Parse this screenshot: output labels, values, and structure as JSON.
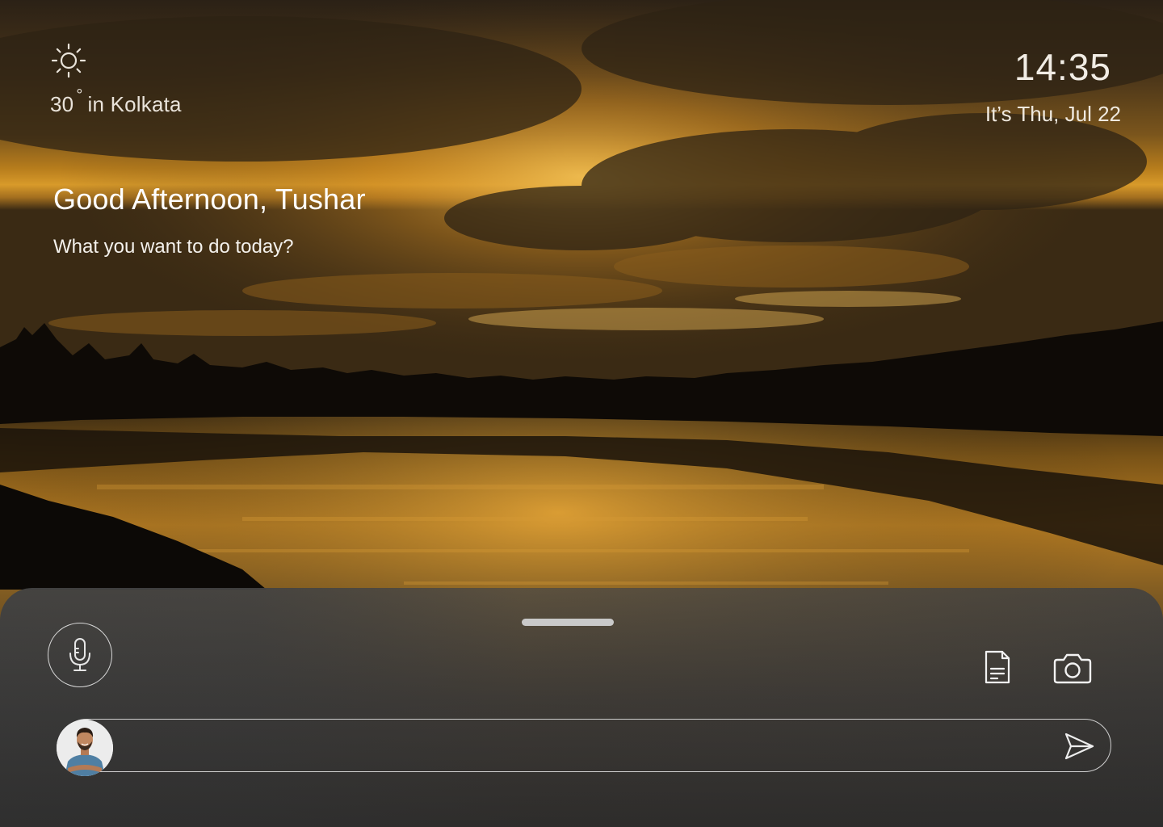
{
  "weather": {
    "icon": "sun-icon",
    "temperature": "30",
    "degree_symbol": "°",
    "location": "in Kolkata"
  },
  "clock": {
    "time": "14:35",
    "date": "It’s Thu, Jul 22"
  },
  "greeting": {
    "title": "Good Afternoon, Tushar",
    "subtitle": "What you want to do today?"
  },
  "assistant_sheet": {
    "mic_icon": "microphone-icon",
    "document_icon": "document-icon",
    "camera_icon": "camera-icon",
    "send_icon": "send-icon",
    "input": {
      "value": "",
      "placeholder": ""
    },
    "user_avatar": "user-avatar"
  },
  "colors": {
    "sheet_background": "#3a3a3a",
    "outline": "#d9d9d9",
    "text_primary": "#ffffff"
  }
}
